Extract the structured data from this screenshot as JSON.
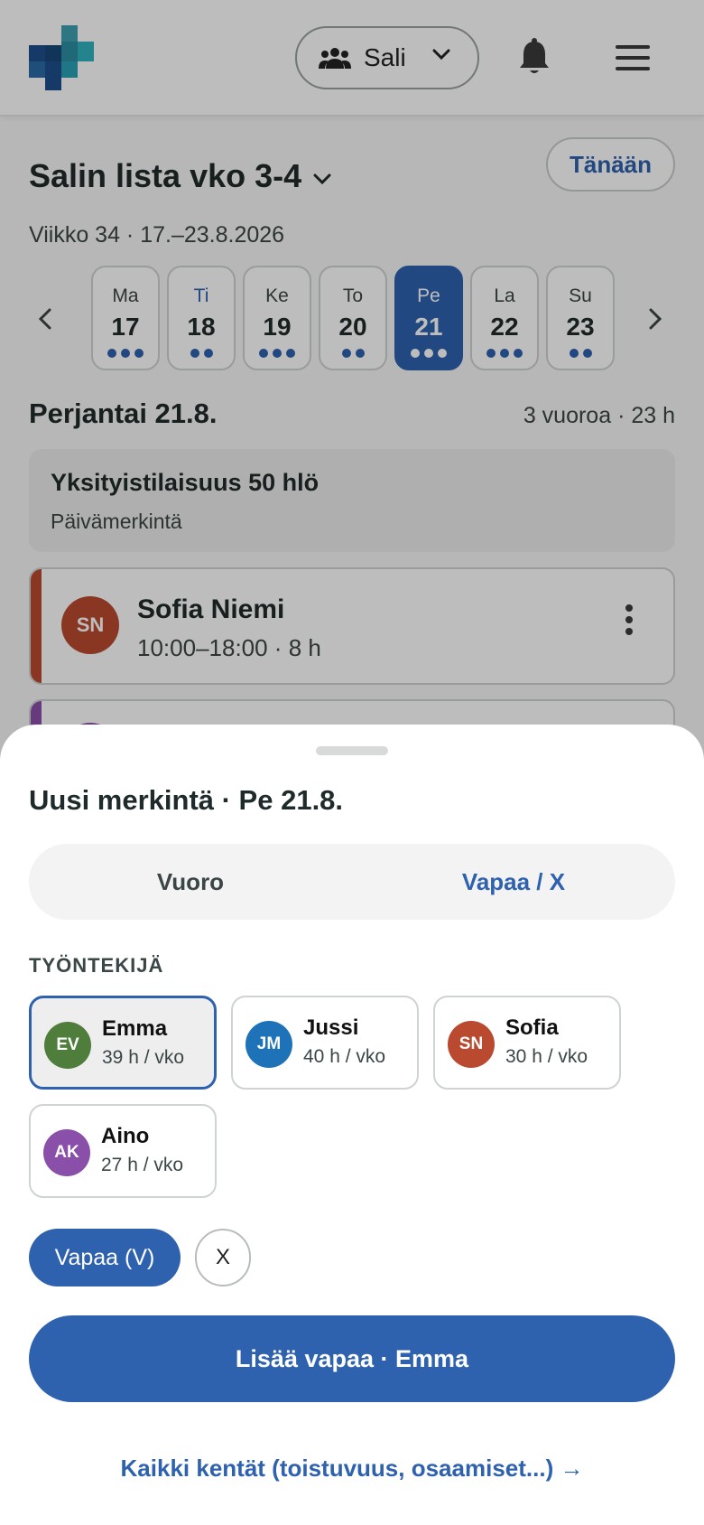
{
  "header": {
    "site_label": "Sali",
    "icons": [
      "app-logo",
      "people-icon",
      "chevron-down-icon",
      "bell-icon",
      "menu-icon"
    ]
  },
  "page": {
    "title": "Salin lista vko 3-4",
    "today_button": "Tänään",
    "week_subtitle": "Viikko 34 · 17.–23.8.2026"
  },
  "week_days": [
    {
      "name": "Ma",
      "date": "17",
      "dots": 3
    },
    {
      "name": "Ti",
      "date": "18",
      "dots": 2
    },
    {
      "name": "Ke",
      "date": "19",
      "dots": 3
    },
    {
      "name": "To",
      "date": "20",
      "dots": 2
    },
    {
      "name": "Pe",
      "date": "21",
      "dots": 3,
      "selected": true
    },
    {
      "name": "La",
      "date": "22",
      "dots": 3
    },
    {
      "name": "Su",
      "date": "23",
      "dots": 2
    }
  ],
  "day": {
    "heading": "Perjantai 21.8.",
    "summary": "3 vuoroa · 23 h",
    "event": {
      "title": "Yksityistilaisuus 50 hlö",
      "subtitle": "Päivämerkintä"
    },
    "shift": {
      "initials": "SN",
      "name": "Sofia Niemi",
      "time": "10:00–18:00 · 8 h"
    }
  },
  "sheet": {
    "title": "Uusi merkintä · Pe 21.8.",
    "tabs": [
      {
        "label": "Vuoro",
        "active": false
      },
      {
        "label": "Vapaa / X",
        "active": true
      }
    ],
    "section_label": "TYÖNTEKIJÄ",
    "employees": [
      {
        "initials": "EV",
        "name": "Emma",
        "hours": "39 h / vko",
        "color": "#4e7d3c",
        "selected": true
      },
      {
        "initials": "JM",
        "name": "Jussi",
        "hours": "40 h / vko",
        "color": "#1e73b8"
      },
      {
        "initials": "SN",
        "name": "Sofia",
        "hours": "30 h / vko",
        "color": "#b9492f"
      },
      {
        "initials": "AK",
        "name": "Aino",
        "hours": "27 h / vko",
        "color": "#8a4fa8"
      }
    ],
    "chips": {
      "vapaa": "Vapaa (V)",
      "x": "X"
    },
    "primary_button": "Lisää vapaa · Emma",
    "all_fields_link": "Kaikki kentät (toistuvuus, osaamiset...) →"
  },
  "colors": {
    "accent": "#2f62ae",
    "text": "#1f2a2a"
  }
}
